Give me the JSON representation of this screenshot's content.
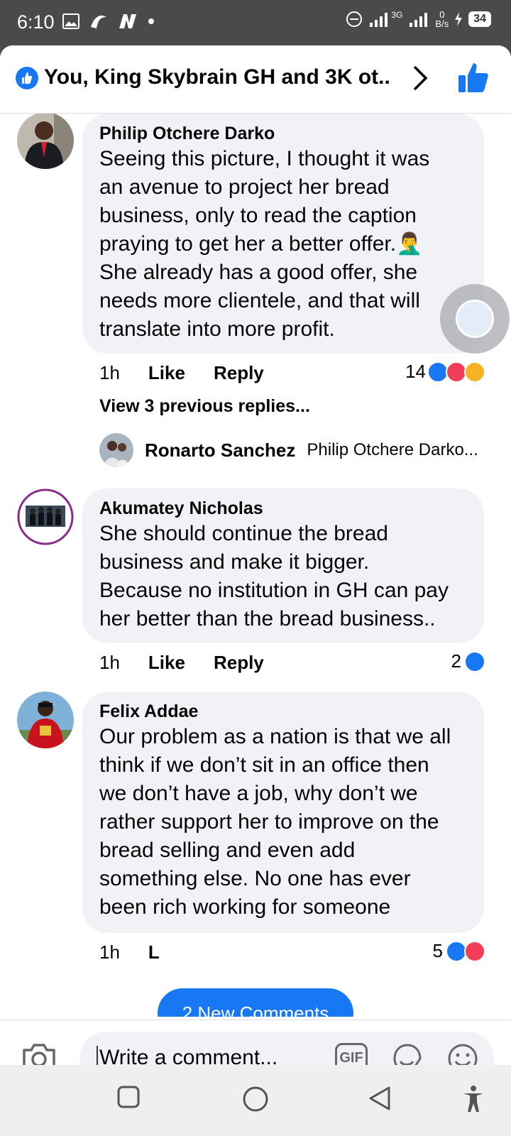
{
  "status_bar": {
    "time": "6:10",
    "network": "3G",
    "speed_value": "0",
    "speed_unit": "B/s",
    "battery": "34"
  },
  "header": {
    "title": "You, King Skybrain GH and 3K ot..."
  },
  "comments": [
    {
      "name": "Philip Otchere Darko",
      "text": "Seeing this picture, I thought it was\nan avenue to project her bread\nbusiness, only to read the caption\npraying to get her a better offer.🤦‍♂️\nShe already has a good offer, she\nneeds more clientele, and that will\ntranslate into more profit.",
      "time": "1h",
      "like_label": "Like",
      "reply_label": "Reply",
      "reaction_count": "14"
    },
    {
      "name": "Akumatey Nicholas",
      "text": "She should continue the bread\nbusiness and make it bigger.\nBecause no institution in GH can pay\nher better than the bread business..",
      "time": "1h",
      "like_label": "Like",
      "reply_label": "Reply",
      "reaction_count": "2"
    },
    {
      "name": "Felix Addae",
      "text": "Our problem as a nation is that we all\nthink if we don’t sit in an office then\nwe don’t have a job, why don’t we\nrather support her to improve on the\nbread selling and even add\nsomething else. No one has ever\nbeen rich working for someone",
      "time": "1h",
      "like_label": "L",
      "reaction_count": "5"
    }
  ],
  "replies_section": {
    "view_previous": "View 3 previous replies...",
    "reply_name": "Ronarto Sanchez",
    "reply_preview": "Philip Otchere Darko..."
  },
  "new_comments_pill": "2 New Comments",
  "composer": {
    "placeholder": "Write a comment...",
    "gif_label": "GIF"
  },
  "colors": {
    "facebook_blue": "#1877f2",
    "bubble_gray": "#f0f2f5",
    "love_red": "#f33e58",
    "haha_yellow": "#f7b125"
  }
}
